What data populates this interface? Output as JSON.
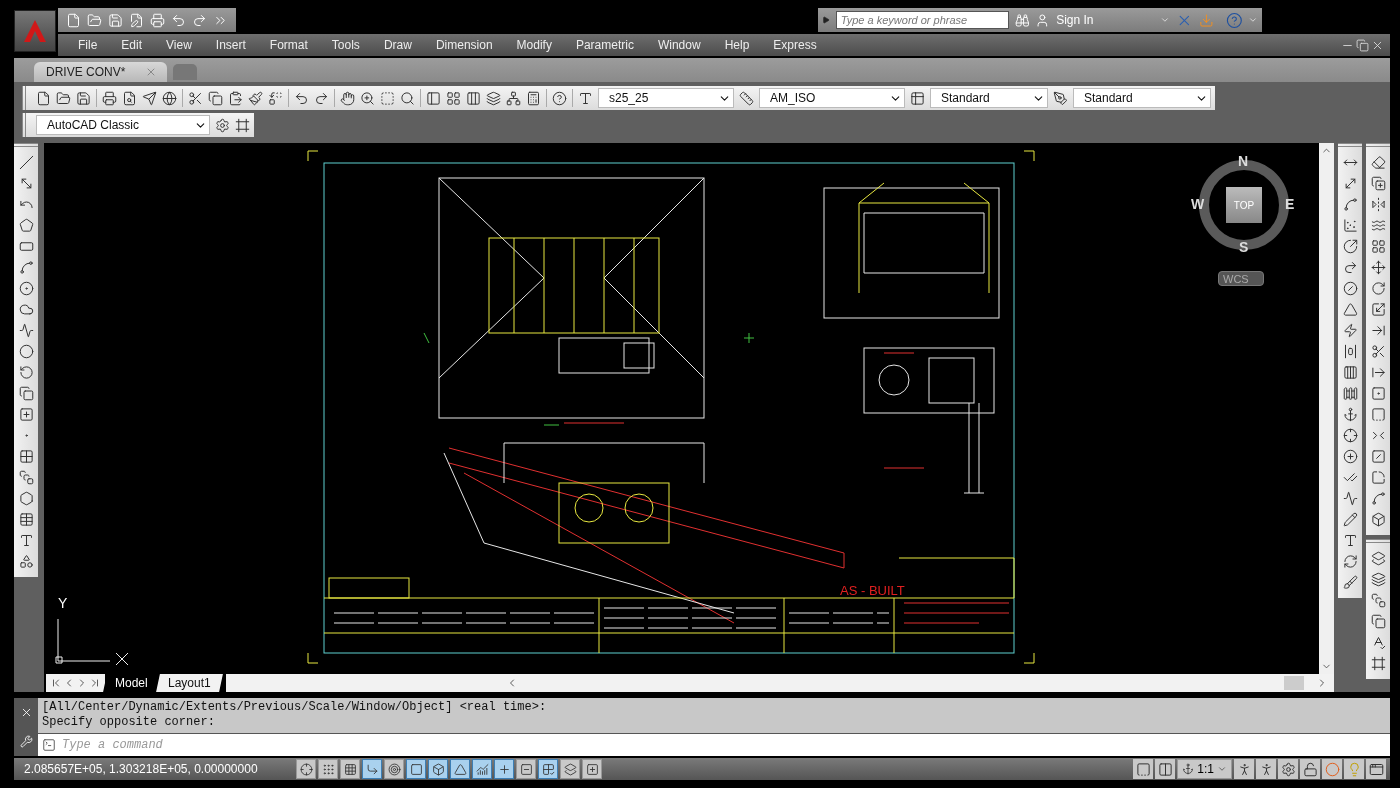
{
  "search": {
    "placeholder": "Type a keyword or phrase"
  },
  "sign_in": "Sign In",
  "menu": [
    "File",
    "Edit",
    "View",
    "Insert",
    "Format",
    "Tools",
    "Draw",
    "Dimension",
    "Modify",
    "Parametric",
    "Window",
    "Help",
    "Express"
  ],
  "document_tabs": [
    {
      "label": "DRIVE CONV*",
      "selected": true
    }
  ],
  "style_toolbar": {
    "text_style": "s25_25",
    "dim_style": "AM_ISO",
    "table_style": "Standard",
    "multileader_style": "Standard"
  },
  "workspace": "AutoCAD Classic",
  "viewcube": {
    "north": "N",
    "south": "S",
    "east": "E",
    "west": "W",
    "face": "TOP",
    "ucs": "WCS"
  },
  "ucs_icon": {
    "y_label": "Y"
  },
  "drawing": {
    "stamp": "AS - BUILT"
  },
  "layout_tabs": [
    {
      "label": "Model",
      "selected": true
    },
    {
      "label": "Layout1",
      "selected": false
    }
  ],
  "command_history": [
    "[All/Center/Dynamic/Extents/Previous/Scale/Window/Object] <real time>:",
    "Specify opposite corner:"
  ],
  "command_line": {
    "placeholder": "Type a command"
  },
  "status_bar": {
    "coordinates": "2.085657E+05, 1.303218E+05, 0.00000000",
    "annotation_scale": "1:1",
    "toggles": [
      {
        "on": false
      },
      {
        "on": false
      },
      {
        "on": false
      },
      {
        "on": true
      },
      {
        "on": false
      },
      {
        "on": true
      },
      {
        "on": true
      },
      {
        "on": true
      },
      {
        "on": true
      },
      {
        "on": true
      },
      {
        "on": false
      },
      {
        "on": true
      },
      {
        "on": false
      },
      {
        "on": false
      }
    ]
  }
}
